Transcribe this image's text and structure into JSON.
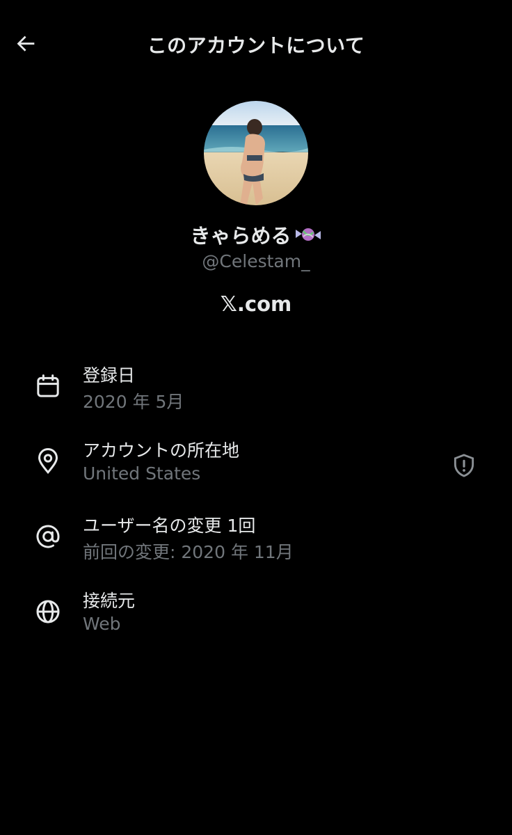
{
  "header": {
    "back_icon": "arrow-left-icon",
    "title": "このアカウントについて"
  },
  "profile": {
    "avatar_alt": "profile photo",
    "display_name": "きゃらめる",
    "display_name_emoji": "candy-icon",
    "handle": "@Celestam_",
    "site_logo": "𝕏",
    "site_text": ".com"
  },
  "info": [
    {
      "icon": "calendar-icon",
      "title": "登録日",
      "value": "2020 年 5月"
    },
    {
      "icon": "location-pin-icon",
      "title": "アカウントの所在地",
      "value": "United States",
      "badge_icon": "shield-alert-icon"
    },
    {
      "icon": "at-sign-icon",
      "title": "ユーザー名の変更 1回",
      "value": "前回の変更: 2020 年 11月"
    },
    {
      "icon": "globe-icon",
      "title": "接続元",
      "value": "Web"
    }
  ],
  "colors": {
    "background": "#000000",
    "primary_text": "#e7e9ea",
    "secondary_text": "#71767b"
  }
}
